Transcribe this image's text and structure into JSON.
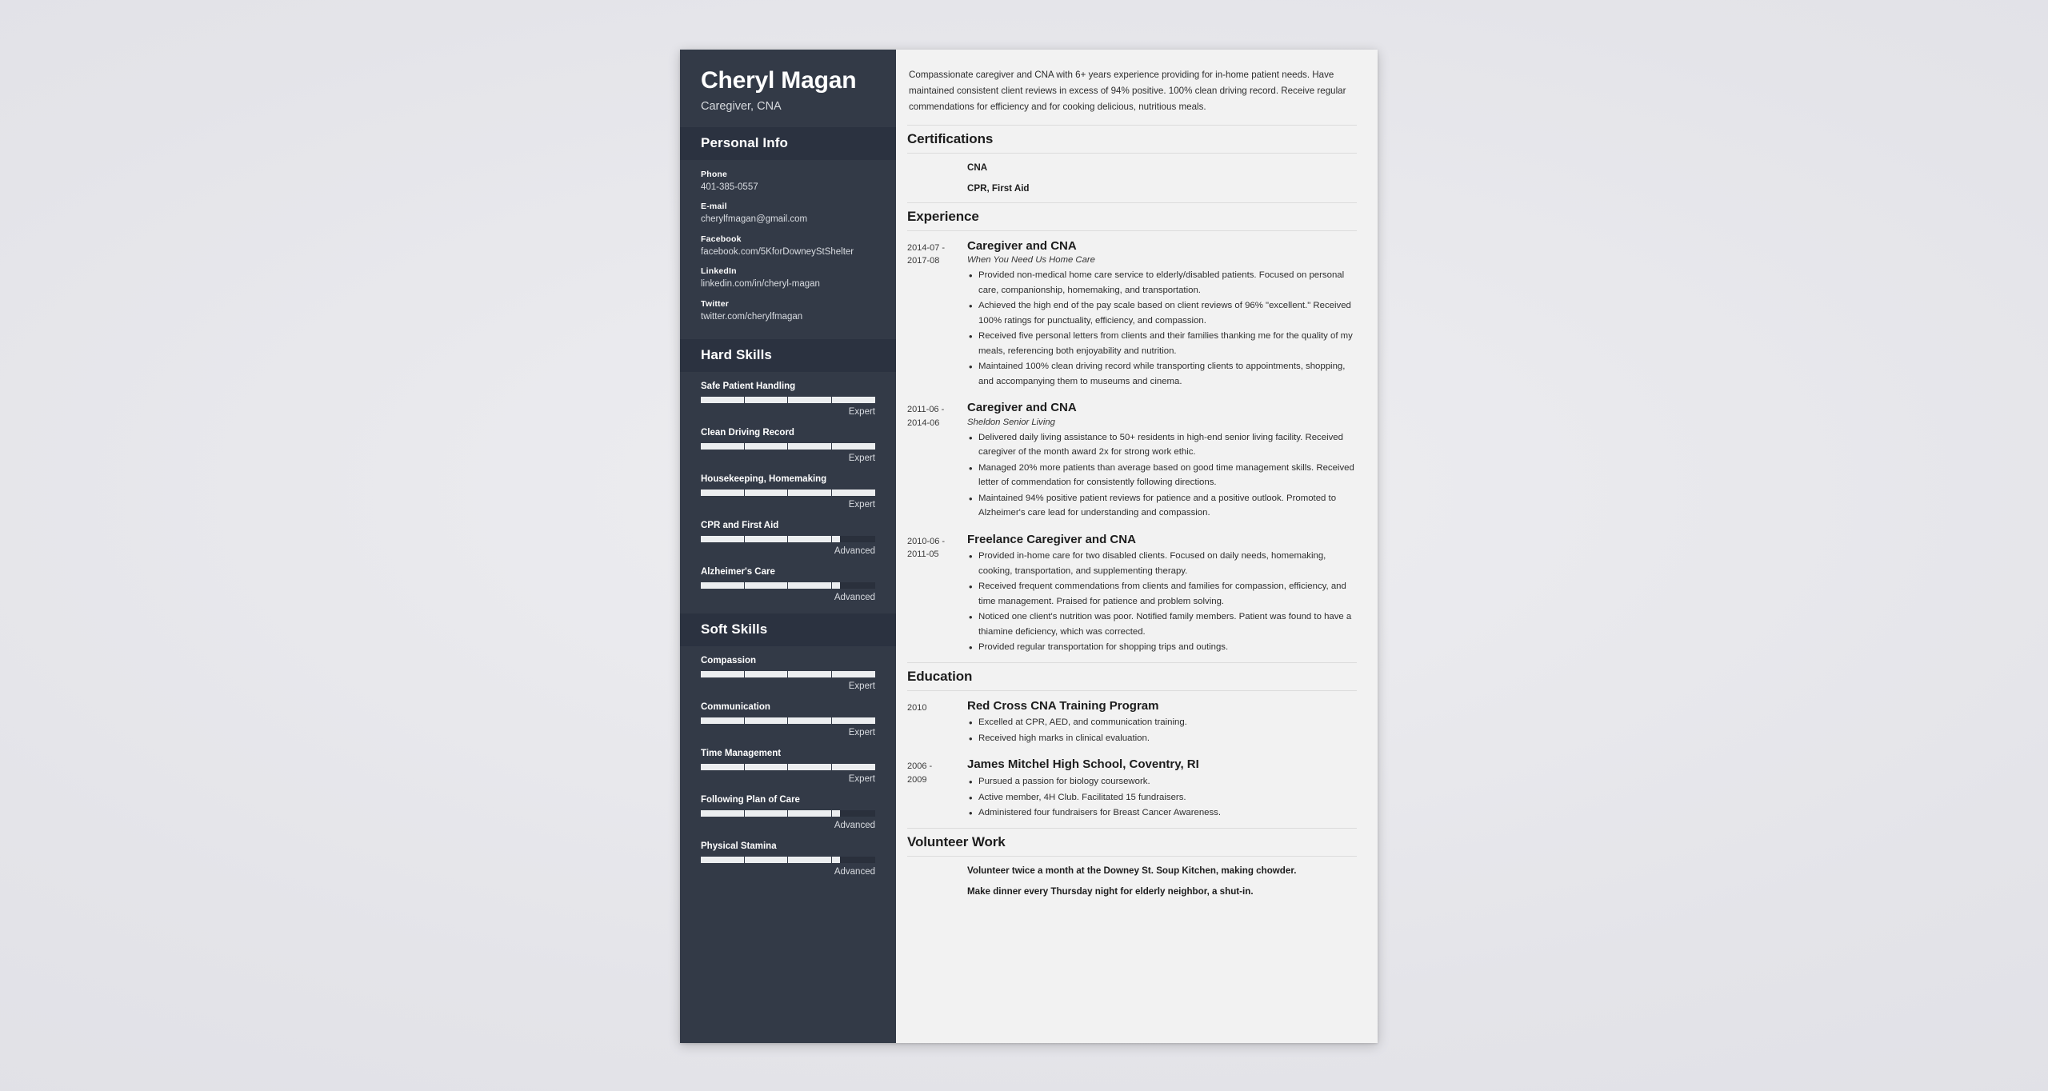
{
  "theme": {
    "sidebar_bg": "#333a47",
    "sidebar_header_bg": "#2b3240",
    "page_bg": "#f2f2f2",
    "backdrop": "#e9e9ed",
    "bar_fill": "#eceef0"
  },
  "sidebar": {
    "name": "Cheryl Magan",
    "title": "Caregiver, CNA",
    "personal_info": {
      "heading": "Personal Info",
      "items": [
        {
          "label": "Phone",
          "value": "401-385-0557"
        },
        {
          "label": "E-mail",
          "value": "cherylfmagan@gmail.com"
        },
        {
          "label": "Facebook",
          "value": "facebook.com/5KforDowneyStShelter"
        },
        {
          "label": "LinkedIn",
          "value": "linkedin.com/in/cheryl-magan"
        },
        {
          "label": "Twitter",
          "value": "twitter.com/cherylfmagan"
        }
      ]
    },
    "hard_skills": {
      "heading": "Hard Skills",
      "items": [
        {
          "name": "Safe Patient Handling",
          "level": "Expert",
          "percent": 100
        },
        {
          "name": "Clean Driving Record",
          "level": "Expert",
          "percent": 100
        },
        {
          "name": "Housekeeping, Homemaking",
          "level": "Expert",
          "percent": 100
        },
        {
          "name": "CPR and First Aid",
          "level": "Advanced",
          "percent": 80
        },
        {
          "name": "Alzheimer's Care",
          "level": "Advanced",
          "percent": 80
        }
      ]
    },
    "soft_skills": {
      "heading": "Soft Skills",
      "items": [
        {
          "name": "Compassion",
          "level": "Expert",
          "percent": 100
        },
        {
          "name": "Communication",
          "level": "Expert",
          "percent": 100
        },
        {
          "name": "Time Management",
          "level": "Expert",
          "percent": 100
        },
        {
          "name": "Following Plan of Care",
          "level": "Advanced",
          "percent": 80
        },
        {
          "name": "Physical Stamina",
          "level": "Advanced",
          "percent": 80
        }
      ]
    }
  },
  "main": {
    "summary": "Compassionate caregiver and CNA with 6+ years experience providing for in-home patient needs. Have maintained consistent client reviews in excess of 94% positive. 100% clean driving record. Receive regular commendations for efficiency and for cooking delicious, nutritious meals.",
    "certifications": {
      "heading": "Certifications",
      "items": [
        "CNA",
        "CPR, First Aid"
      ]
    },
    "experience": {
      "heading": "Experience",
      "entries": [
        {
          "date": "2014-07 - 2017-08",
          "title": "Caregiver and CNA",
          "org": "When You Need Us Home Care",
          "bullets": [
            "Provided non-medical home care service to elderly/disabled patients. Focused on personal care, companionship, homemaking, and transportation.",
            "Achieved the high end of the pay scale based on client reviews of 96% \"excellent.\" Received 100% ratings for punctuality, efficiency, and compassion.",
            "Received five personal letters from clients and their families thanking me for the quality of my meals, referencing both enjoyability and nutrition.",
            "Maintained 100% clean driving record while transporting clients to appointments, shopping, and accompanying them to museums and cinema."
          ]
        },
        {
          "date": "2011-06 - 2014-06",
          "title": "Caregiver and CNA",
          "org": "Sheldon Senior Living",
          "bullets": [
            "Delivered daily living assistance to 50+ residents in high-end senior living facility. Received caregiver of the month award 2x for strong work ethic.",
            "Managed 20% more patients than average based on good time management skills. Received letter of commendation for consistently following directions.",
            "Maintained 94% positive patient reviews for patience and a positive outlook. Promoted to Alzheimer's care lead for understanding and compassion."
          ]
        },
        {
          "date": "2010-06 - 2011-05",
          "title": "Freelance Caregiver and CNA",
          "org": "",
          "bullets": [
            "Provided in-home care for two disabled clients. Focused on daily needs, homemaking, cooking, transportation, and supplementing therapy.",
            "Received frequent commendations from clients and families for compassion, efficiency, and time management. Praised for patience and problem solving.",
            "Noticed one client's nutrition was poor. Notified family members. Patient was found to have a thiamine deficiency, which was corrected.",
            "Provided regular transportation for shopping trips and outings."
          ]
        }
      ]
    },
    "education": {
      "heading": "Education",
      "entries": [
        {
          "date": "2010",
          "title": "Red Cross CNA Training Program",
          "org": "",
          "bullets": [
            "Excelled at CPR, AED, and communication training.",
            "Received high marks in clinical evaluation."
          ]
        },
        {
          "date": "2006 - 2009",
          "title": "James Mitchel High School, Coventry, RI",
          "org": "",
          "bullets": [
            "Pursued a passion for biology coursework.",
            "Active member, 4H Club. Facilitated 15 fundraisers.",
            "Administered four fundraisers for Breast Cancer Awareness."
          ]
        }
      ]
    },
    "volunteer": {
      "heading": "Volunteer Work",
      "items": [
        "Volunteer twice a month at the Downey St. Soup Kitchen, making chowder.",
        "Make dinner every Thursday night for elderly neighbor, a shut-in."
      ]
    }
  }
}
